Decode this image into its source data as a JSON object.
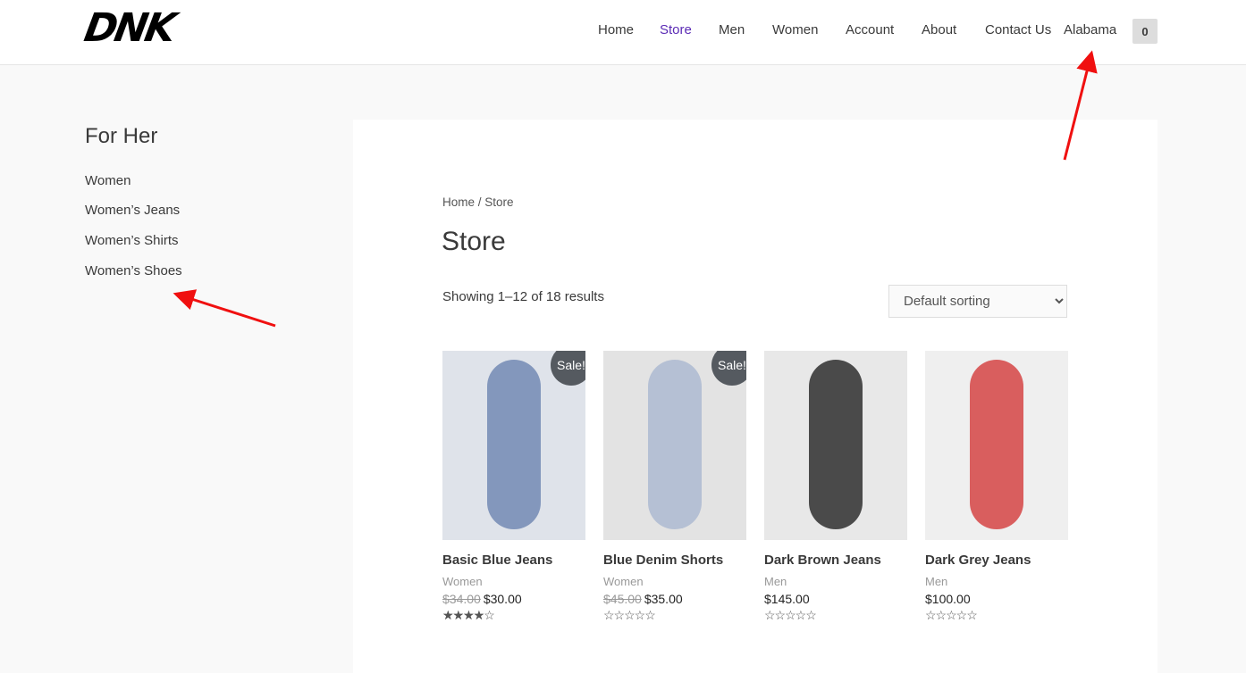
{
  "header": {
    "logo": "DNK",
    "nav": [
      {
        "label": "Home",
        "active": false
      },
      {
        "label": "Store",
        "active": true
      },
      {
        "label": "Men",
        "active": false
      },
      {
        "label": "Women",
        "active": false
      },
      {
        "label": "Account",
        "active": false
      },
      {
        "label": "About",
        "active": false
      },
      {
        "label": "Contact Us",
        "active": false
      },
      {
        "label": "Alabama",
        "active": false
      }
    ],
    "cart_count": "0"
  },
  "sidebar": {
    "title": "For Her",
    "items": [
      "Women",
      "Women’s Jeans",
      "Women’s Shirts",
      "Women’s Shoes"
    ]
  },
  "main": {
    "breadcrumb": "Home / Store",
    "title": "Store",
    "result_count": "Showing 1–12 of 18 results",
    "sorting": "Default sorting",
    "products": [
      {
        "name": "Basic Blue Jeans",
        "category": "Women",
        "old_price": "$34.00",
        "price": "$30.00",
        "sale": "Sale!",
        "rating": 4,
        "image": "woman-legs-jeans-heels"
      },
      {
        "name": "Blue Denim Shorts",
        "category": "Women",
        "old_price": "$45.00",
        "price": "$35.00",
        "sale": "Sale!",
        "rating": 0,
        "image": "woman-legs-denim-shorts"
      },
      {
        "name": "Dark Brown Jeans",
        "category": "Men",
        "old_price": "",
        "price": "$145.00",
        "sale": "",
        "rating": 0,
        "image": "black-braided-bracelet"
      },
      {
        "name": "Dark Grey Jeans",
        "category": "Men",
        "old_price": "",
        "price": "$100.00",
        "sale": "",
        "rating": 0,
        "image": "red-handbag"
      }
    ]
  },
  "annotations": {
    "arrow_color": "#f01010"
  }
}
